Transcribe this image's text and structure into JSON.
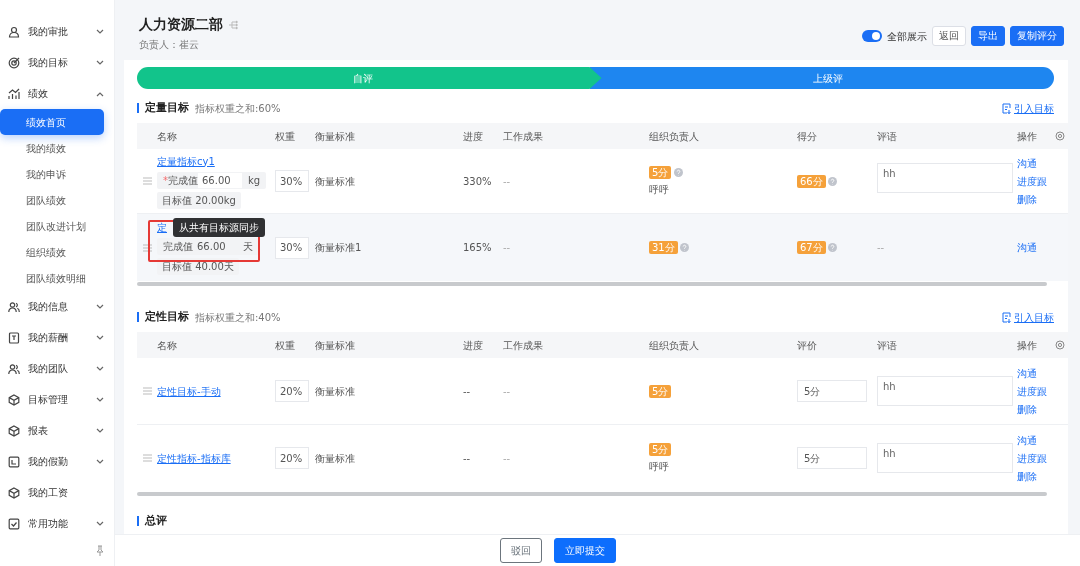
{
  "sidebar": {
    "items": [
      {
        "label": "我的审批",
        "expanded": false
      },
      {
        "label": "我的目标",
        "expanded": false
      },
      {
        "label": "绩效",
        "expanded": true,
        "children": [
          {
            "label": "绩效首页",
            "selected": true
          },
          {
            "label": "我的绩效",
            "selected": false
          },
          {
            "label": "我的申诉",
            "selected": false
          },
          {
            "label": "团队绩效",
            "selected": false
          },
          {
            "label": "团队改进计划",
            "selected": false
          },
          {
            "label": "组织绩效",
            "selected": false
          },
          {
            "label": "团队绩效明细",
            "selected": false
          }
        ]
      },
      {
        "label": "我的信息",
        "expanded": false
      },
      {
        "label": "我的薪酬",
        "expanded": false
      },
      {
        "label": "我的团队",
        "expanded": false
      },
      {
        "label": "目标管理",
        "expanded": false
      },
      {
        "label": "报表",
        "expanded": false
      },
      {
        "label": "我的假勤",
        "expanded": false
      },
      {
        "label": "我的工资"
      },
      {
        "label": "常用功能",
        "expanded": false
      }
    ]
  },
  "header": {
    "title": "人力资源二部",
    "owner": "负责人：崔云",
    "show_all": {
      "label": "全部展示",
      "on": true
    },
    "buttons": [
      {
        "label": "返回",
        "kind": "outline"
      },
      {
        "label": "导出",
        "kind": "primary"
      },
      {
        "label": "复制评分",
        "kind": "primary"
      }
    ]
  },
  "steps": [
    {
      "label": "自评",
      "color": "#12c48b"
    },
    {
      "label": "上级评",
      "color": "#1e86f0"
    }
  ],
  "sections": [
    {
      "title": "定量目标",
      "note": "指标权重之和:60%",
      "link": "引入目标",
      "columns": [
        "名称",
        "权重",
        "衡量标准",
        "进度",
        "工作成果",
        "组织负责人",
        "得分",
        "评语",
        "操作"
      ],
      "rows": [
        {
          "name": "定量指标cy1",
          "actual": {
            "required_mark": "*",
            "label": "完成值",
            "value": "66.00",
            "unit": "kg"
          },
          "target": "目标值 20.00kg",
          "weight": "30%",
          "standard": "衡量标准",
          "progress": "330%",
          "result": "--",
          "leader_score": "5分",
          "leader_comment": "呼呼",
          "score": {
            "kind": "badge",
            "value": "66分"
          },
          "comment": {
            "kind": "field",
            "value": "hh"
          },
          "actions": [
            "沟通",
            "进度跟",
            "删除"
          ],
          "hovered": false
        },
        {
          "name": "定",
          "actual": {
            "label": "完成值",
            "value": "66.00",
            "unit": "天"
          },
          "target": "目标值 40.00天",
          "weight": "30%",
          "standard": "衡量标准1",
          "progress": "165%",
          "result": "--",
          "leader_score": "31分",
          "score": {
            "kind": "badge",
            "value": "67分"
          },
          "comment": {
            "kind": "text",
            "value": "--"
          },
          "actions": [
            "沟通"
          ],
          "hovered": true,
          "tooltip": "从共有目标源同步",
          "outlined": true
        }
      ]
    },
    {
      "title": "定性目标",
      "note": "指标权重之和:40%",
      "link": "引入目标",
      "columns": [
        "名称",
        "权重",
        "衡量标准",
        "进度",
        "工作成果",
        "组织负责人",
        "评价",
        "评语",
        "操作"
      ],
      "rows": [
        {
          "name": "定性目标-手动",
          "weight": "20%",
          "standard": "衡量标准",
          "progress": "--",
          "result": "--",
          "leader_score": "5分",
          "score": {
            "kind": "field",
            "value": "5分"
          },
          "comment": {
            "kind": "field",
            "value": "hh"
          },
          "actions": [
            "沟通",
            "进度跟",
            "删除"
          ]
        },
        {
          "name": "定性指标-指标库",
          "weight": "20%",
          "standard": "衡量标准",
          "progress": "--",
          "result": "--",
          "leader_score": "5分",
          "leader_comment": "呼呼",
          "score": {
            "kind": "field",
            "value": "5分"
          },
          "comment": {
            "kind": "field",
            "value": "hh"
          },
          "actions": [
            "沟通",
            "进度跟",
            "删除"
          ]
        }
      ]
    }
  ],
  "summary_title": "总评",
  "footer": {
    "buttons": [
      {
        "label": "驳回",
        "kind": "outline"
      },
      {
        "label": "立即提交",
        "kind": "primary"
      }
    ]
  }
}
